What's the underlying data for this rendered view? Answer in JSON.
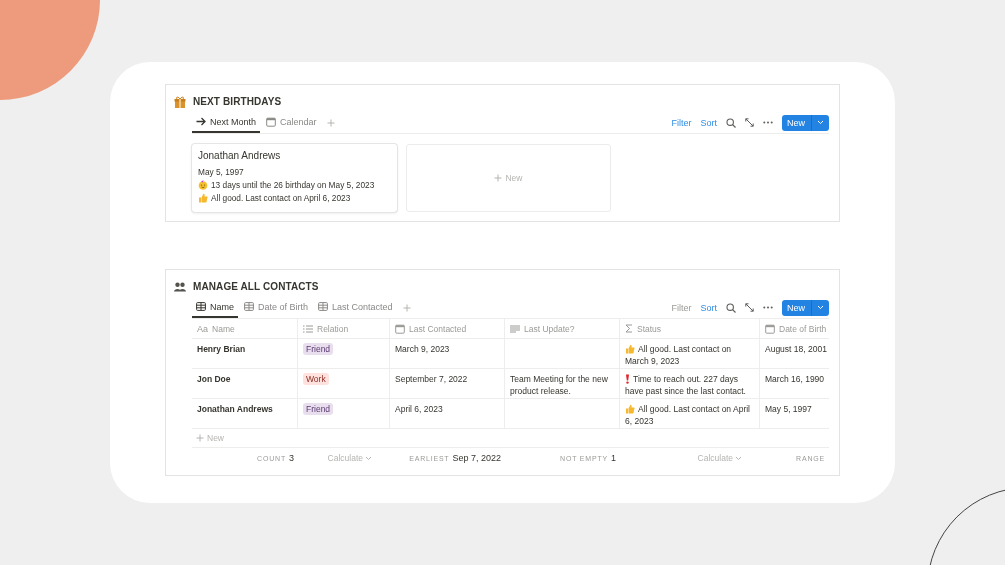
{
  "sections": [
    {
      "kind": "gallery",
      "title": "NEXT BIRTHDAYS",
      "tabs": [
        {
          "label": "Next Month",
          "kind": "list",
          "selected": true
        },
        {
          "label": "Calendar",
          "kind": "calendar",
          "selected": false
        }
      ],
      "toolbar": {
        "filter": {
          "label": "Filter",
          "active": true
        },
        "sort": {
          "label": "Sort",
          "active": true
        },
        "new": "New"
      },
      "cards": [
        {
          "title": "Jonathan Andrews",
          "lines": [
            {
              "kind": "plain",
              "text": "May 5, 1997"
            },
            {
              "kind": "party",
              "text": "13 days until the 26 birthday on May 5, 2023"
            },
            {
              "kind": "good",
              "text": "All good. Last contact on April 6, 2023"
            }
          ]
        }
      ],
      "new_card": "New"
    },
    {
      "kind": "table",
      "title": "MANAGE ALL CONTACTS",
      "tabs": [
        {
          "label": "Name",
          "kind": "table",
          "selected": true
        },
        {
          "label": "Date of Birth",
          "kind": "table",
          "selected": false
        },
        {
          "label": "Last Contacted",
          "kind": "table",
          "selected": false
        }
      ],
      "toolbar": {
        "filter": {
          "label": "Filter",
          "active": false
        },
        "sort": {
          "label": "Sort",
          "active": true
        },
        "new": "New"
      },
      "columns": [
        {
          "label": "Name",
          "kind": "title",
          "mark": "Aa"
        },
        {
          "label": "Relation",
          "kind": "select"
        },
        {
          "label": "Last Contacted",
          "kind": "date"
        },
        {
          "label": "Last Update?",
          "kind": "text"
        },
        {
          "label": "Status",
          "kind": "formula"
        },
        {
          "label": "Date of Birth",
          "kind": "date"
        }
      ],
      "rows": [
        {
          "name": "Henry Brian",
          "relation": {
            "label": "Friend",
            "color": "#e8deee"
          },
          "last_contacted": "March 9, 2023",
          "status": {
            "kind": "good",
            "text": "All good. Last contact on March 9, 2023"
          },
          "date_of_birth": "August 18, 2001"
        },
        {
          "name": "Jon Doe",
          "relation": {
            "label": "Work",
            "color": "#ffe2dd"
          },
          "last_contacted": "September 7, 2022",
          "last_update": "Team Meeting for the new product release.",
          "status": {
            "kind": "alert",
            "text": "Time to reach out. 227 days have past since the last contact."
          },
          "date_of_birth": "March 16, 1990"
        },
        {
          "name": "Jonathan Andrews",
          "relation": {
            "label": "Friend",
            "color": "#e8deee"
          },
          "last_contacted": "April 6, 2023",
          "status": {
            "kind": "good",
            "text": "All good. Last contact on April 6, 2023"
          },
          "date_of_birth": "May 5, 1997"
        }
      ],
      "new_row": "New",
      "footer": [
        {
          "kind": "value",
          "label": "COUNT",
          "value": "3"
        },
        {
          "kind": "calculate",
          "label": "Calculate"
        },
        {
          "kind": "value",
          "label": "EARLIEST",
          "value": "Sep 7, 2022"
        },
        {
          "kind": "value",
          "label": "NOT EMPTY",
          "value": "1"
        },
        {
          "kind": "calculate",
          "label": "Calculate"
        },
        {
          "kind": "value",
          "label": "RANGE"
        }
      ]
    }
  ]
}
